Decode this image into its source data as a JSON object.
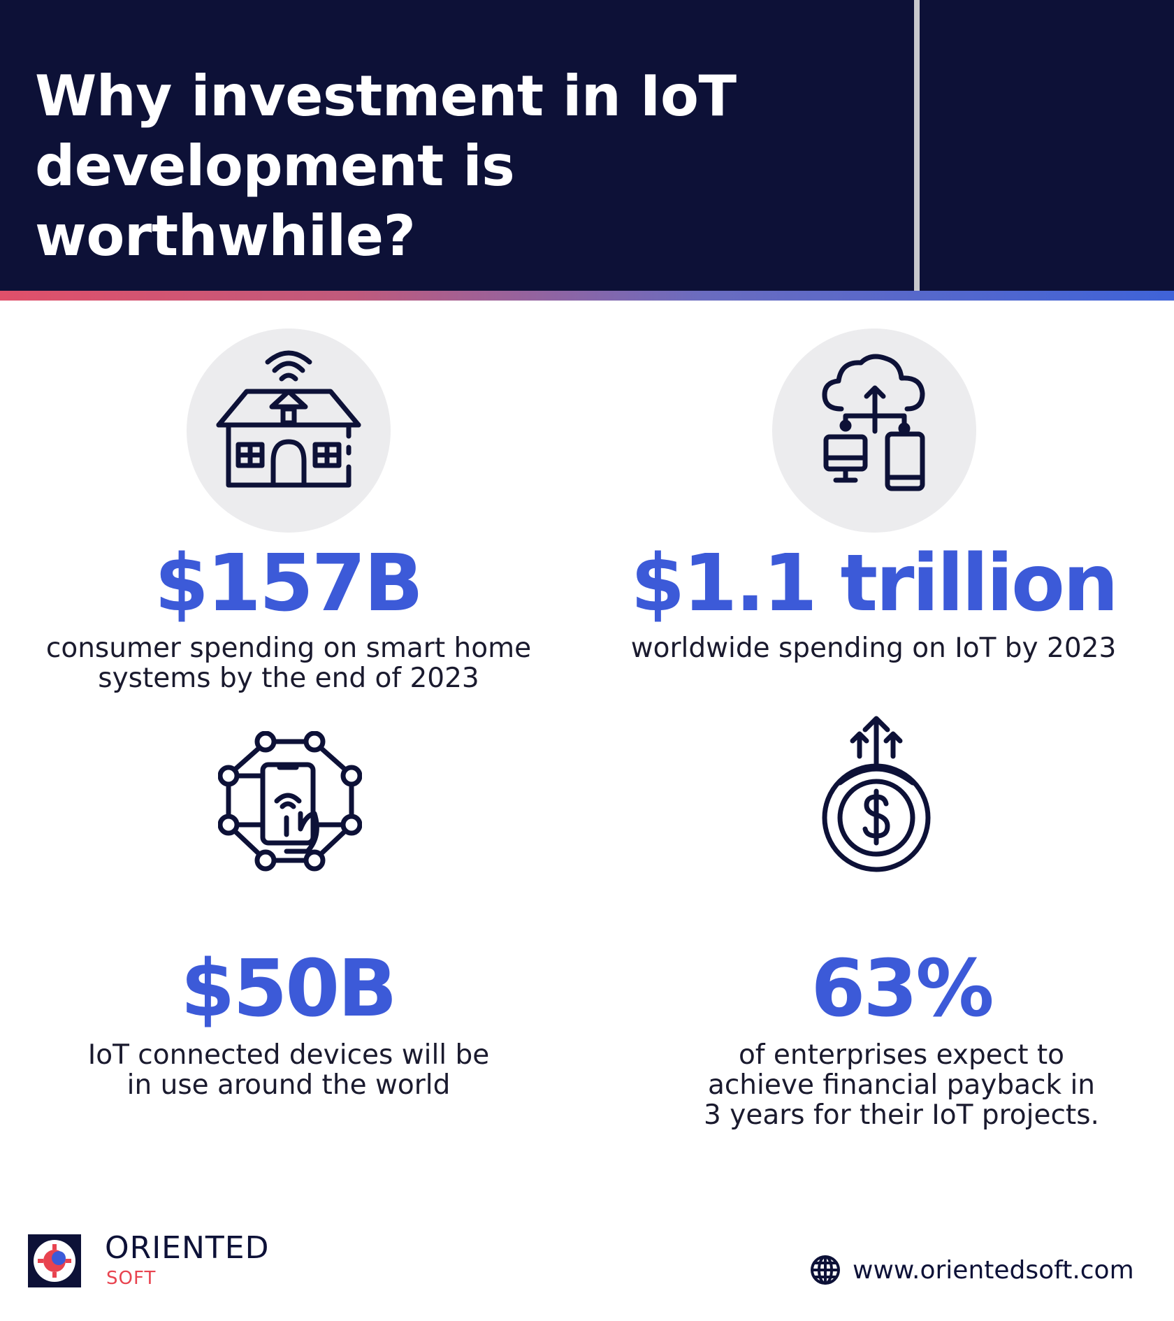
{
  "header": {
    "title_line1": "Why investment in IoT",
    "title_line2": "development is worthwhile?"
  },
  "stats": [
    {
      "value": "$157B",
      "desc_line1": "consumer spending on smart home",
      "desc_line2": "systems by the end of 2023",
      "desc_line3": ""
    },
    {
      "value": "$1.1 trillion",
      "desc_line1": "worldwide spending on IoT by 2023",
      "desc_line2": "",
      "desc_line3": ""
    },
    {
      "value": "$50B",
      "desc_line1": "IoT connected devices will be",
      "desc_line2": "in use around the world",
      "desc_line3": ""
    },
    {
      "value": "63%",
      "desc_line1": "of enterprises expect to",
      "desc_line2": "achieve financial payback in",
      "desc_line3": "3 years for their IoT projects."
    }
  ],
  "icons": [
    "smart-home-icon",
    "cloud-devices-icon",
    "smartphone-network-icon",
    "money-growth-icon",
    "globe-icon"
  ],
  "footer": {
    "brand": "ORIENTED",
    "brand_sub": "SOFT",
    "website": "www.orientedsoft.com"
  },
  "colors": {
    "navy": "#0d1137",
    "accent_blue": "#3c5ad8",
    "accent_pink": "#e0506a",
    "panel_grey": "#ebebed"
  }
}
